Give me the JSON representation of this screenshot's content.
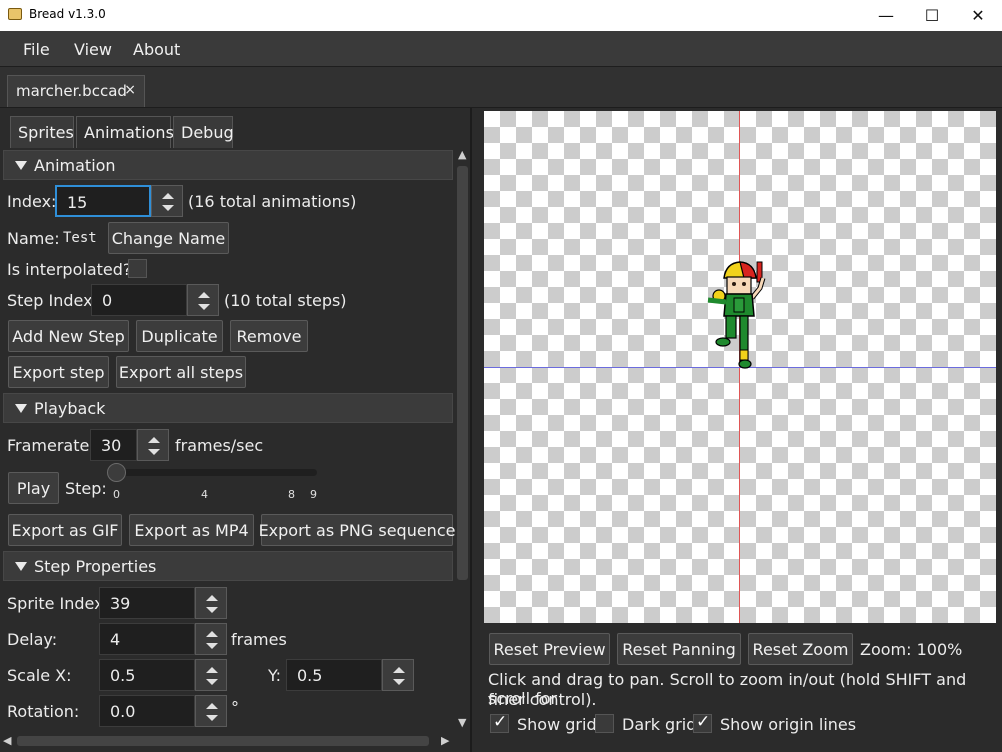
{
  "window": {
    "title": "Bread v1.3.0",
    "minimize": "—",
    "maximize": "☐",
    "close": "✕"
  },
  "menu": {
    "items": [
      "File",
      "View",
      "About"
    ]
  },
  "file_tab": {
    "name": "marcher.bccad",
    "close": "×"
  },
  "panel_tabs": [
    "Sprites",
    "Animations",
    "Debug"
  ],
  "animation": {
    "header": "Animation",
    "index_label": "Index:",
    "index_value": "15",
    "index_total": "(16 total animations)",
    "name_label": "Name:",
    "name_value": "Test",
    "change_name": "Change Name",
    "interpolated_label": "Is interpolated?:",
    "step_index_label": "Step Index:",
    "step_index_value": "0",
    "steps_total": "(10 total steps)",
    "add_new_step": "Add New Step",
    "duplicate": "Duplicate",
    "remove": "Remove",
    "export_step": "Export step",
    "export_all_steps": "Export all steps"
  },
  "playback": {
    "header": "Playback",
    "framerate_label": "Framerate:",
    "framerate_value": "30",
    "framerate_unit": "frames/sec",
    "play": "Play",
    "step_label": "Step:",
    "step_value": 0,
    "step_ticks": [
      "0",
      "4",
      "8",
      "9"
    ],
    "export_gif": "Export as GIF",
    "export_mp4": "Export as MP4",
    "export_png": "Export as PNG sequence"
  },
  "step_properties": {
    "header": "Step Properties",
    "sprite_index_label": "Sprite Index:",
    "sprite_index_value": "39",
    "delay_label": "Delay:",
    "delay_value": "4",
    "delay_unit": "frames",
    "scale_x_label": "Scale X:",
    "scale_x_value": "0.5",
    "y_label": "Y:",
    "y_value": "0.5",
    "rotation_label": "Rotation:",
    "rotation_value": "0.0",
    "rotation_unit": "°"
  },
  "preview": {
    "reset_preview": "Reset Preview",
    "reset_panning": "Reset Panning",
    "reset_zoom": "Reset Zoom",
    "zoom": "Zoom: 100%",
    "hint_line1": "Click and drag to pan. Scroll to zoom in/out (hold SHIFT and scroll for",
    "hint_line2": "finer control).",
    "show_grid": "Show grid",
    "dark_grid": "Dark grid",
    "show_origin_lines": "Show origin lines",
    "show_grid_checked": true,
    "dark_grid_checked": false,
    "show_origin_checked": true
  },
  "colors": {
    "focus_accent": "#2f8fd8",
    "origin_vertical": "#e05555",
    "origin_horizontal": "#6b6bdd"
  }
}
